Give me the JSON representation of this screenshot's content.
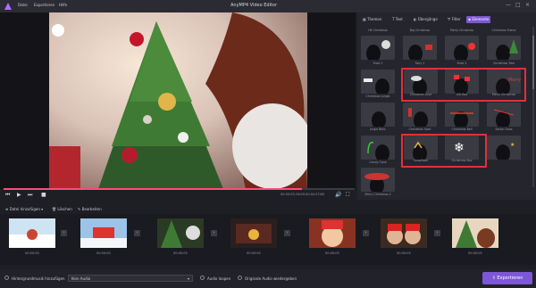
{
  "window": {
    "title": "AnyMP4 Video Editor",
    "menu": [
      "Datei",
      "Exportieren",
      "Hilfe"
    ],
    "controls": [
      "—",
      "□",
      "×"
    ]
  },
  "player": {
    "timecode": "00:00:03.29/00:00:04.07/00",
    "progress": 0.85
  },
  "tools": {
    "add": "Datei hinzufügen",
    "delete": "Löschen",
    "edit": "Bearbeiten"
  },
  "panel_tabs": [
    {
      "label": "Themen",
      "icon": "theme-icon"
    },
    {
      "label": "Text",
      "icon": "text-icon"
    },
    {
      "label": "Übergänge",
      "icon": "transition-icon"
    },
    {
      "label": "Filter",
      "icon": "filter-icon"
    },
    {
      "label": "Elemente",
      "icon": "elements-icon",
      "active": true
    }
  ],
  "elements": {
    "top_labels": [
      "Hit Christmas",
      "Big Christmas",
      "Merry Christmas",
      "Christmas Frame"
    ],
    "row1": [
      "Frost 1",
      "Fairy 1",
      "Frost 2",
      "Christmas Tree"
    ],
    "row2": [
      "Christmas Jungle",
      "Christmas Love",
      "Gift Box",
      "Merry Christmas"
    ],
    "row3": [
      "Jingle Bells",
      "Christmas Sock",
      "Christmas Bell",
      "Santa Claus"
    ],
    "row4": [
      "Candy Cane",
      "Snowflake",
      "Christmas Star"
    ],
    "row5": [
      "Merry Christmas 2"
    ]
  },
  "timeline_clips": [
    "00:00:05",
    "00:00:05",
    "00:00:05",
    "00:00:05",
    "00:00:05",
    "00:00:05",
    "00:00:05"
  ],
  "footer": {
    "bgm_label": "Hintergrundmusik hinzufügen",
    "bgm_value": "Kein Audio",
    "loop_label": "Audio loopen",
    "keep_label": "Originale Audio wiedergeben",
    "export": "Exportieren"
  },
  "colors": {
    "accent": "#7d57d4",
    "selection": "#e23038",
    "progress": "#ff4a7e"
  }
}
